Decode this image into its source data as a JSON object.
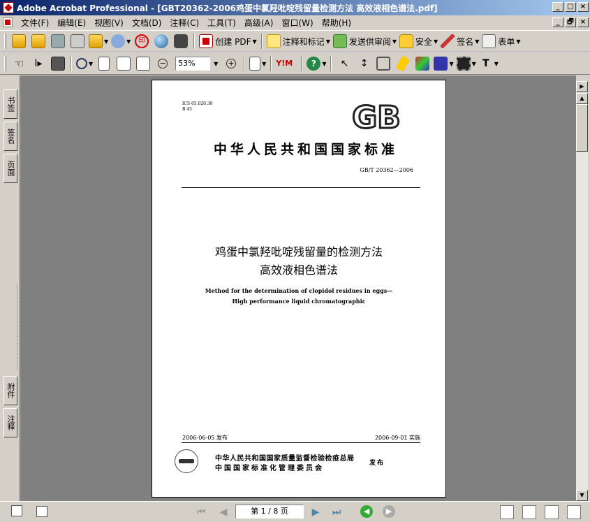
{
  "window": {
    "title": "Adobe Acrobat Professional - [GBT20362-2006鸡蛋中氯羟吡啶残留量检测方法 高效液相色谱法.pdf]",
    "minimize": "_",
    "maximize": "□",
    "close": "×",
    "restore": "🗗"
  },
  "menu": [
    "文件(F)",
    "编辑(E)",
    "视图(V)",
    "文档(D)",
    "注释(C)",
    "工具(T)",
    "高级(A)",
    "窗口(W)",
    "帮助(H)"
  ],
  "toolbar1": {
    "create_pdf": "创建 PDF",
    "comment_mark": "注释和标记",
    "send_review": "发送供审阅",
    "security": "安全",
    "sign": "签名",
    "forms": "表单"
  },
  "toolbar2": {
    "zoom_value": "53%",
    "yim": "Y!M"
  },
  "side_tabs": {
    "bookmarks": "书签",
    "signatures": "签名",
    "pages": "页面",
    "attachments": "附件",
    "comments": "注释"
  },
  "document": {
    "ics_line1": "ICS 65.020.30",
    "ics_line2": "B 45",
    "gb_logo": "GB",
    "national_std": "中华人民共和国国家标准",
    "std_number": "GB/T 20362—2006",
    "title_cn_1": "鸡蛋中氯羟吡啶残留量的检测方法",
    "title_cn_2": "高效液相色谱法",
    "title_en_1": "Method for the determination of clopidol residues in eggs—",
    "title_en_2": "High performance liquid chromatographic",
    "issue_date": "2006-06-05 发布",
    "impl_date": "2006-09-01 实施",
    "authority_1": "中华人民共和国国家质量监督检验检疫总局",
    "authority_2": "中国国家标准化管理委员会",
    "publish": "发布"
  },
  "status": {
    "page_indicator": "第 1 / 8 页"
  }
}
